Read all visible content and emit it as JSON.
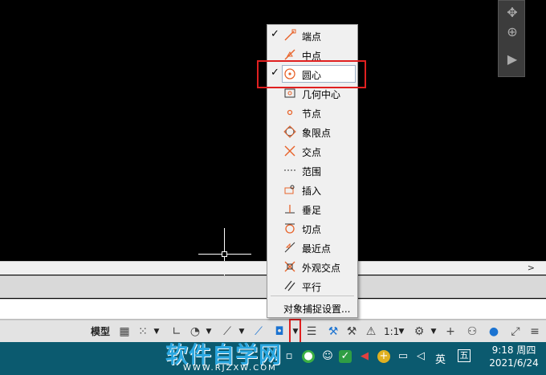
{
  "osnap_menu": {
    "items": [
      {
        "label": "端点",
        "checked": "✓",
        "icon": "endpoint-icon"
      },
      {
        "label": "中点",
        "checked": "",
        "icon": "midpoint-icon"
      },
      {
        "label": "圆心",
        "checked": "✓",
        "icon": "center-icon"
      },
      {
        "label": "几何中心",
        "checked": "",
        "icon": "geometric-center-icon"
      },
      {
        "label": "节点",
        "checked": "",
        "icon": "node-icon"
      },
      {
        "label": "象限点",
        "checked": "",
        "icon": "quadrant-icon"
      },
      {
        "label": "交点",
        "checked": "",
        "icon": "intersection-icon"
      },
      {
        "label": "范围",
        "checked": "",
        "icon": "extension-icon"
      },
      {
        "label": "插入",
        "checked": "",
        "icon": "insert-icon"
      },
      {
        "label": "垂足",
        "checked": "",
        "icon": "perpendicular-icon"
      },
      {
        "label": "切点",
        "checked": "",
        "icon": "tangent-icon"
      },
      {
        "label": "最近点",
        "checked": "",
        "icon": "nearest-icon"
      },
      {
        "label": "外观交点",
        "checked": "",
        "icon": "apparent-intersection-icon"
      },
      {
        "label": "平行",
        "checked": "",
        "icon": "parallel-icon"
      }
    ],
    "settings_label": "对象捕捉设置..."
  },
  "statusbar": {
    "model_label": "模型",
    "scale_label": "1:1"
  },
  "watermark": {
    "title": "软件自学网",
    "url": "WWW.RJZXW.COM"
  },
  "taskbar": {
    "ime_label": "英",
    "ime_mode": "五",
    "time": "9:18 周四",
    "date": "2021/6/24"
  },
  "colors": {
    "accent_red": "#e02020",
    "snap_orange": "#e8632a",
    "taskbar": "#0b5a6f"
  }
}
